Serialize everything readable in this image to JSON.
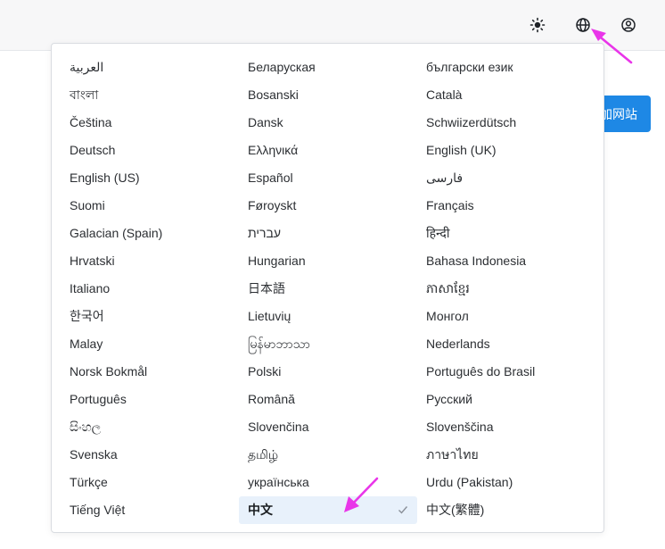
{
  "topbar": {
    "icons": [
      "sun-icon",
      "globe-icon",
      "user-icon"
    ]
  },
  "background": {
    "button_label": "加网站"
  },
  "language_menu": {
    "columns": [
      [
        "العربية",
        "বাংলা",
        "Čeština",
        "Deutsch",
        "English (US)",
        "Suomi",
        "Galacian (Spain)",
        "Hrvatski",
        "Italiano",
        "한국어",
        "Malay",
        "Norsk Bokmål",
        "Português",
        "සිංහල",
        "Svenska",
        "Türkçe",
        "Tiếng Việt"
      ],
      [
        "Беларуская",
        "Bosanski",
        "Dansk",
        "Ελληνικά",
        "Español",
        "Føroyskt",
        "עברית",
        "Hungarian",
        "日本語",
        "Lietuvių",
        "မြန်မာဘာသာ",
        "Polski",
        "Română",
        "Slovenčina",
        "தமிழ்",
        "українська",
        "中文"
      ],
      [
        "български език",
        "Català",
        "Schwiizerdütsch",
        "English (UK)",
        "فارسی",
        "Français",
        "हिन्दी",
        "Bahasa Indonesia",
        "ភាសាខ្មែរ",
        "Монгол",
        "Nederlands",
        "Português do Brasil",
        "Русский",
        "Slovenščina",
        "ภาษาไทย",
        "Urdu (Pakistan)",
        "中文(繁體)"
      ]
    ],
    "selected": "中文"
  },
  "colors": {
    "accent": "#1e88e5",
    "annotation_arrow": "#e935e9",
    "selected_bg": "#e8f1fb"
  }
}
